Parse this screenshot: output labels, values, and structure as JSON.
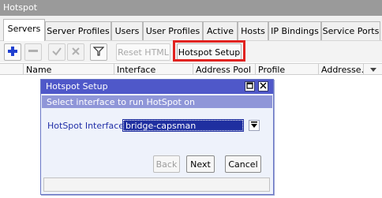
{
  "window": {
    "title": "Hotspot"
  },
  "tabs": [
    {
      "label": "Servers"
    },
    {
      "label": "Server Profiles"
    },
    {
      "label": "Users"
    },
    {
      "label": "User Profiles"
    },
    {
      "label": "Active"
    },
    {
      "label": "Hosts"
    },
    {
      "label": "IP Bindings"
    },
    {
      "label": "Service Ports"
    }
  ],
  "toolbar": {
    "icons": [
      "add-icon",
      "remove-icon",
      "enable-icon",
      "disable-icon",
      "filter-icon"
    ],
    "reset_html_label": "Reset HTML",
    "hotspot_setup_label": "Hotspot Setup"
  },
  "table": {
    "columns": [
      "Name",
      "Interface",
      "Address Pool",
      "Profile",
      "Addresse..."
    ],
    "rows": []
  },
  "dialog": {
    "title": "Hotspot Setup",
    "instruction": "Select interface to run HotSpot on",
    "field_label": "HotSpot Interface:",
    "field_value": "bridge-capsman",
    "back_label": "Back",
    "next_label": "Next",
    "cancel_label": "Cancel"
  },
  "colors": {
    "highlight": "#e12320",
    "dialog_title_bg": "#4f58c9",
    "dialog_banner_bg": "#8f96d8",
    "field_label": "#2230a8"
  }
}
